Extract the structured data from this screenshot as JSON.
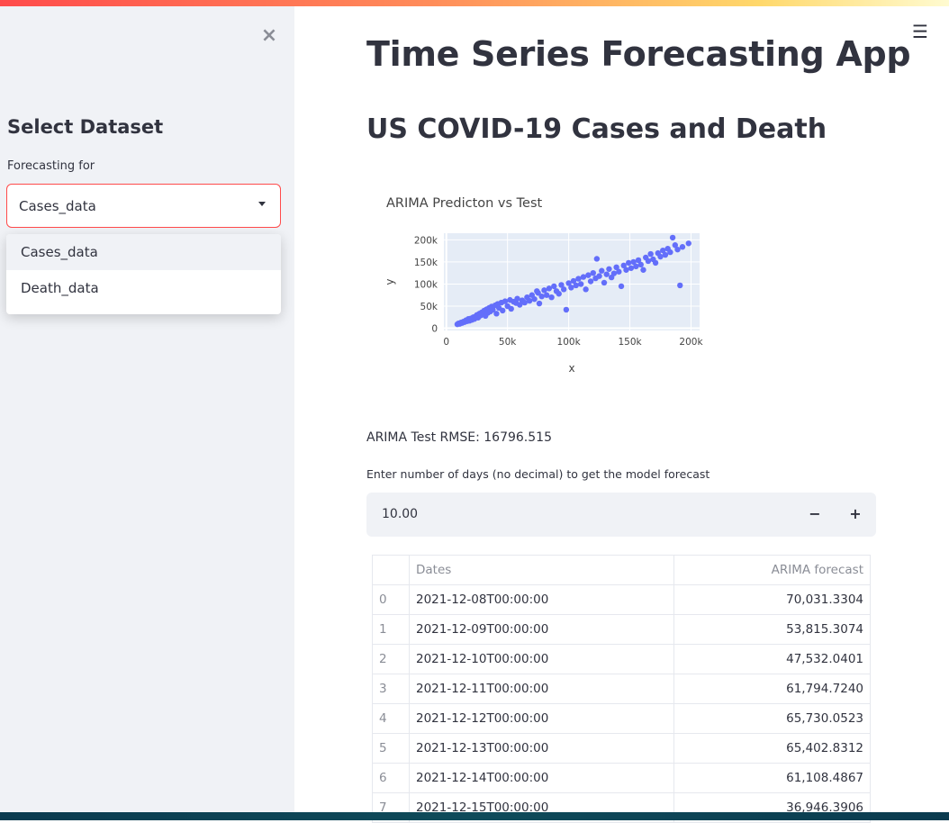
{
  "sidebar": {
    "heading": "Select Dataset",
    "label": "Forecasting for",
    "selected": "Cases_data",
    "options": [
      "Cases_data",
      "Death_data"
    ]
  },
  "main": {
    "title": "Time Series Forecasting App",
    "subtitle": "US COVID-19 Cases and Death",
    "rmse_text": "ARIMA Test RMSE: 16796.515",
    "number_label": "Enter number of days (no decimal) to get the model forecast",
    "number_value": "10.00",
    "table": {
      "headers": [
        "",
        "Dates",
        "ARIMA forecast"
      ],
      "rows": [
        [
          "0",
          "2021-12-08T00:00:00",
          "70,031.3304"
        ],
        [
          "1",
          "2021-12-09T00:00:00",
          "53,815.3074"
        ],
        [
          "2",
          "2021-12-10T00:00:00",
          "47,532.0401"
        ],
        [
          "3",
          "2021-12-11T00:00:00",
          "61,794.7240"
        ],
        [
          "4",
          "2021-12-12T00:00:00",
          "65,730.0523"
        ],
        [
          "5",
          "2021-12-13T00:00:00",
          "65,402.8312"
        ],
        [
          "6",
          "2021-12-14T00:00:00",
          "61,108.4867"
        ],
        [
          "7",
          "2021-12-15T00:00:00",
          "36,946.3906"
        ]
      ]
    }
  },
  "icons": {
    "close": "close-icon",
    "menu": "hamburger-menu-icon",
    "caret": "chevron-down-icon"
  },
  "colors": {
    "accent": "#ff4b4b",
    "marker": "#636efa",
    "plot_bg": "#e5ecf6",
    "sidebar_bg": "#f0f2f6"
  },
  "chart_data": {
    "type": "scatter",
    "title": "ARIMA Predicton vs Test",
    "xlabel": "x",
    "ylabel": "y",
    "xlim": [
      -2000,
      207000
    ],
    "ylim": [
      -5000,
      215000
    ],
    "xticks": [
      0,
      50000,
      100000,
      150000,
      200000
    ],
    "xtick_labels": [
      "0",
      "50k",
      "100k",
      "150k",
      "200k"
    ],
    "yticks": [
      0,
      50000,
      100000,
      150000,
      200000
    ],
    "ytick_labels": [
      "0",
      "50k",
      "100k",
      "150k",
      "200k"
    ],
    "grid": true,
    "points": [
      [
        9000,
        9000
      ],
      [
        10000,
        11000
      ],
      [
        11000,
        10000
      ],
      [
        12000,
        13000
      ],
      [
        13000,
        12000
      ],
      [
        14000,
        15000
      ],
      [
        15000,
        14000
      ],
      [
        16000,
        18000
      ],
      [
        17000,
        16000
      ],
      [
        18000,
        21000
      ],
      [
        19000,
        17000
      ],
      [
        20000,
        22000
      ],
      [
        21000,
        19000
      ],
      [
        22000,
        25000
      ],
      [
        23000,
        21000
      ],
      [
        24000,
        27000
      ],
      [
        25000,
        30000
      ],
      [
        26000,
        24000
      ],
      [
        27000,
        33000
      ],
      [
        28000,
        29000
      ],
      [
        29000,
        36000
      ],
      [
        30000,
        31000
      ],
      [
        31000,
        40000
      ],
      [
        32000,
        28000
      ],
      [
        33000,
        43000
      ],
      [
        34000,
        35000
      ],
      [
        35000,
        46000
      ],
      [
        36000,
        38000
      ],
      [
        37000,
        49000
      ],
      [
        38000,
        42000
      ],
      [
        40000,
        52000
      ],
      [
        41000,
        33000
      ],
      [
        42000,
        55000
      ],
      [
        43000,
        46000
      ],
      [
        45000,
        58000
      ],
      [
        46000,
        40000
      ],
      [
        48000,
        61000
      ],
      [
        50000,
        50000
      ],
      [
        52000,
        64000
      ],
      [
        53000,
        44000
      ],
      [
        55000,
        60000
      ],
      [
        57000,
        57000
      ],
      [
        58000,
        67000
      ],
      [
        60000,
        53000
      ],
      [
        62000,
        63000
      ],
      [
        64000,
        58000
      ],
      [
        66000,
        70000
      ],
      [
        68000,
        62000
      ],
      [
        70000,
        75000
      ],
      [
        72000,
        66000
      ],
      [
        74000,
        84000
      ],
      [
        75000,
        80000
      ],
      [
        76000,
        56000
      ],
      [
        78000,
        72000
      ],
      [
        80000,
        86000
      ],
      [
        82000,
        75000
      ],
      [
        84000,
        90000
      ],
      [
        86000,
        70000
      ],
      [
        88000,
        95000
      ],
      [
        90000,
        84000
      ],
      [
        92000,
        78000
      ],
      [
        94000,
        98000
      ],
      [
        96000,
        88000
      ],
      [
        98000,
        42000
      ],
      [
        100000,
        102000
      ],
      [
        102000,
        92000
      ],
      [
        104000,
        107000
      ],
      [
        106000,
        97000
      ],
      [
        108000,
        112000
      ],
      [
        110000,
        100000
      ],
      [
        112000,
        116000
      ],
      [
        114000,
        88000
      ],
      [
        116000,
        120000
      ],
      [
        118000,
        106000
      ],
      [
        120000,
        125000
      ],
      [
        122000,
        113000
      ],
      [
        123000,
        157000
      ],
      [
        125000,
        118000
      ],
      [
        127000,
        130000
      ],
      [
        129000,
        103000
      ],
      [
        131000,
        122000
      ],
      [
        133000,
        134000
      ],
      [
        135000,
        115000
      ],
      [
        137000,
        124000
      ],
      [
        139000,
        138000
      ],
      [
        141000,
        128000
      ],
      [
        143000,
        95000
      ],
      [
        145000,
        142000
      ],
      [
        147000,
        132000
      ],
      [
        149000,
        148000
      ],
      [
        151000,
        136000
      ],
      [
        153000,
        150000
      ],
      [
        155000,
        140000
      ],
      [
        157000,
        154000
      ],
      [
        159000,
        144000
      ],
      [
        161000,
        132000
      ],
      [
        163000,
        160000
      ],
      [
        165000,
        152000
      ],
      [
        167000,
        168000
      ],
      [
        169000,
        156000
      ],
      [
        171000,
        148000
      ],
      [
        173000,
        170000
      ],
      [
        175000,
        162000
      ],
      [
        177000,
        176000
      ],
      [
        179000,
        166000
      ],
      [
        181000,
        180000
      ],
      [
        183000,
        172000
      ],
      [
        185000,
        205000
      ],
      [
        187000,
        188000
      ],
      [
        189000,
        178000
      ],
      [
        191000,
        97000
      ],
      [
        193000,
        184000
      ],
      [
        198000,
        192000
      ]
    ]
  }
}
